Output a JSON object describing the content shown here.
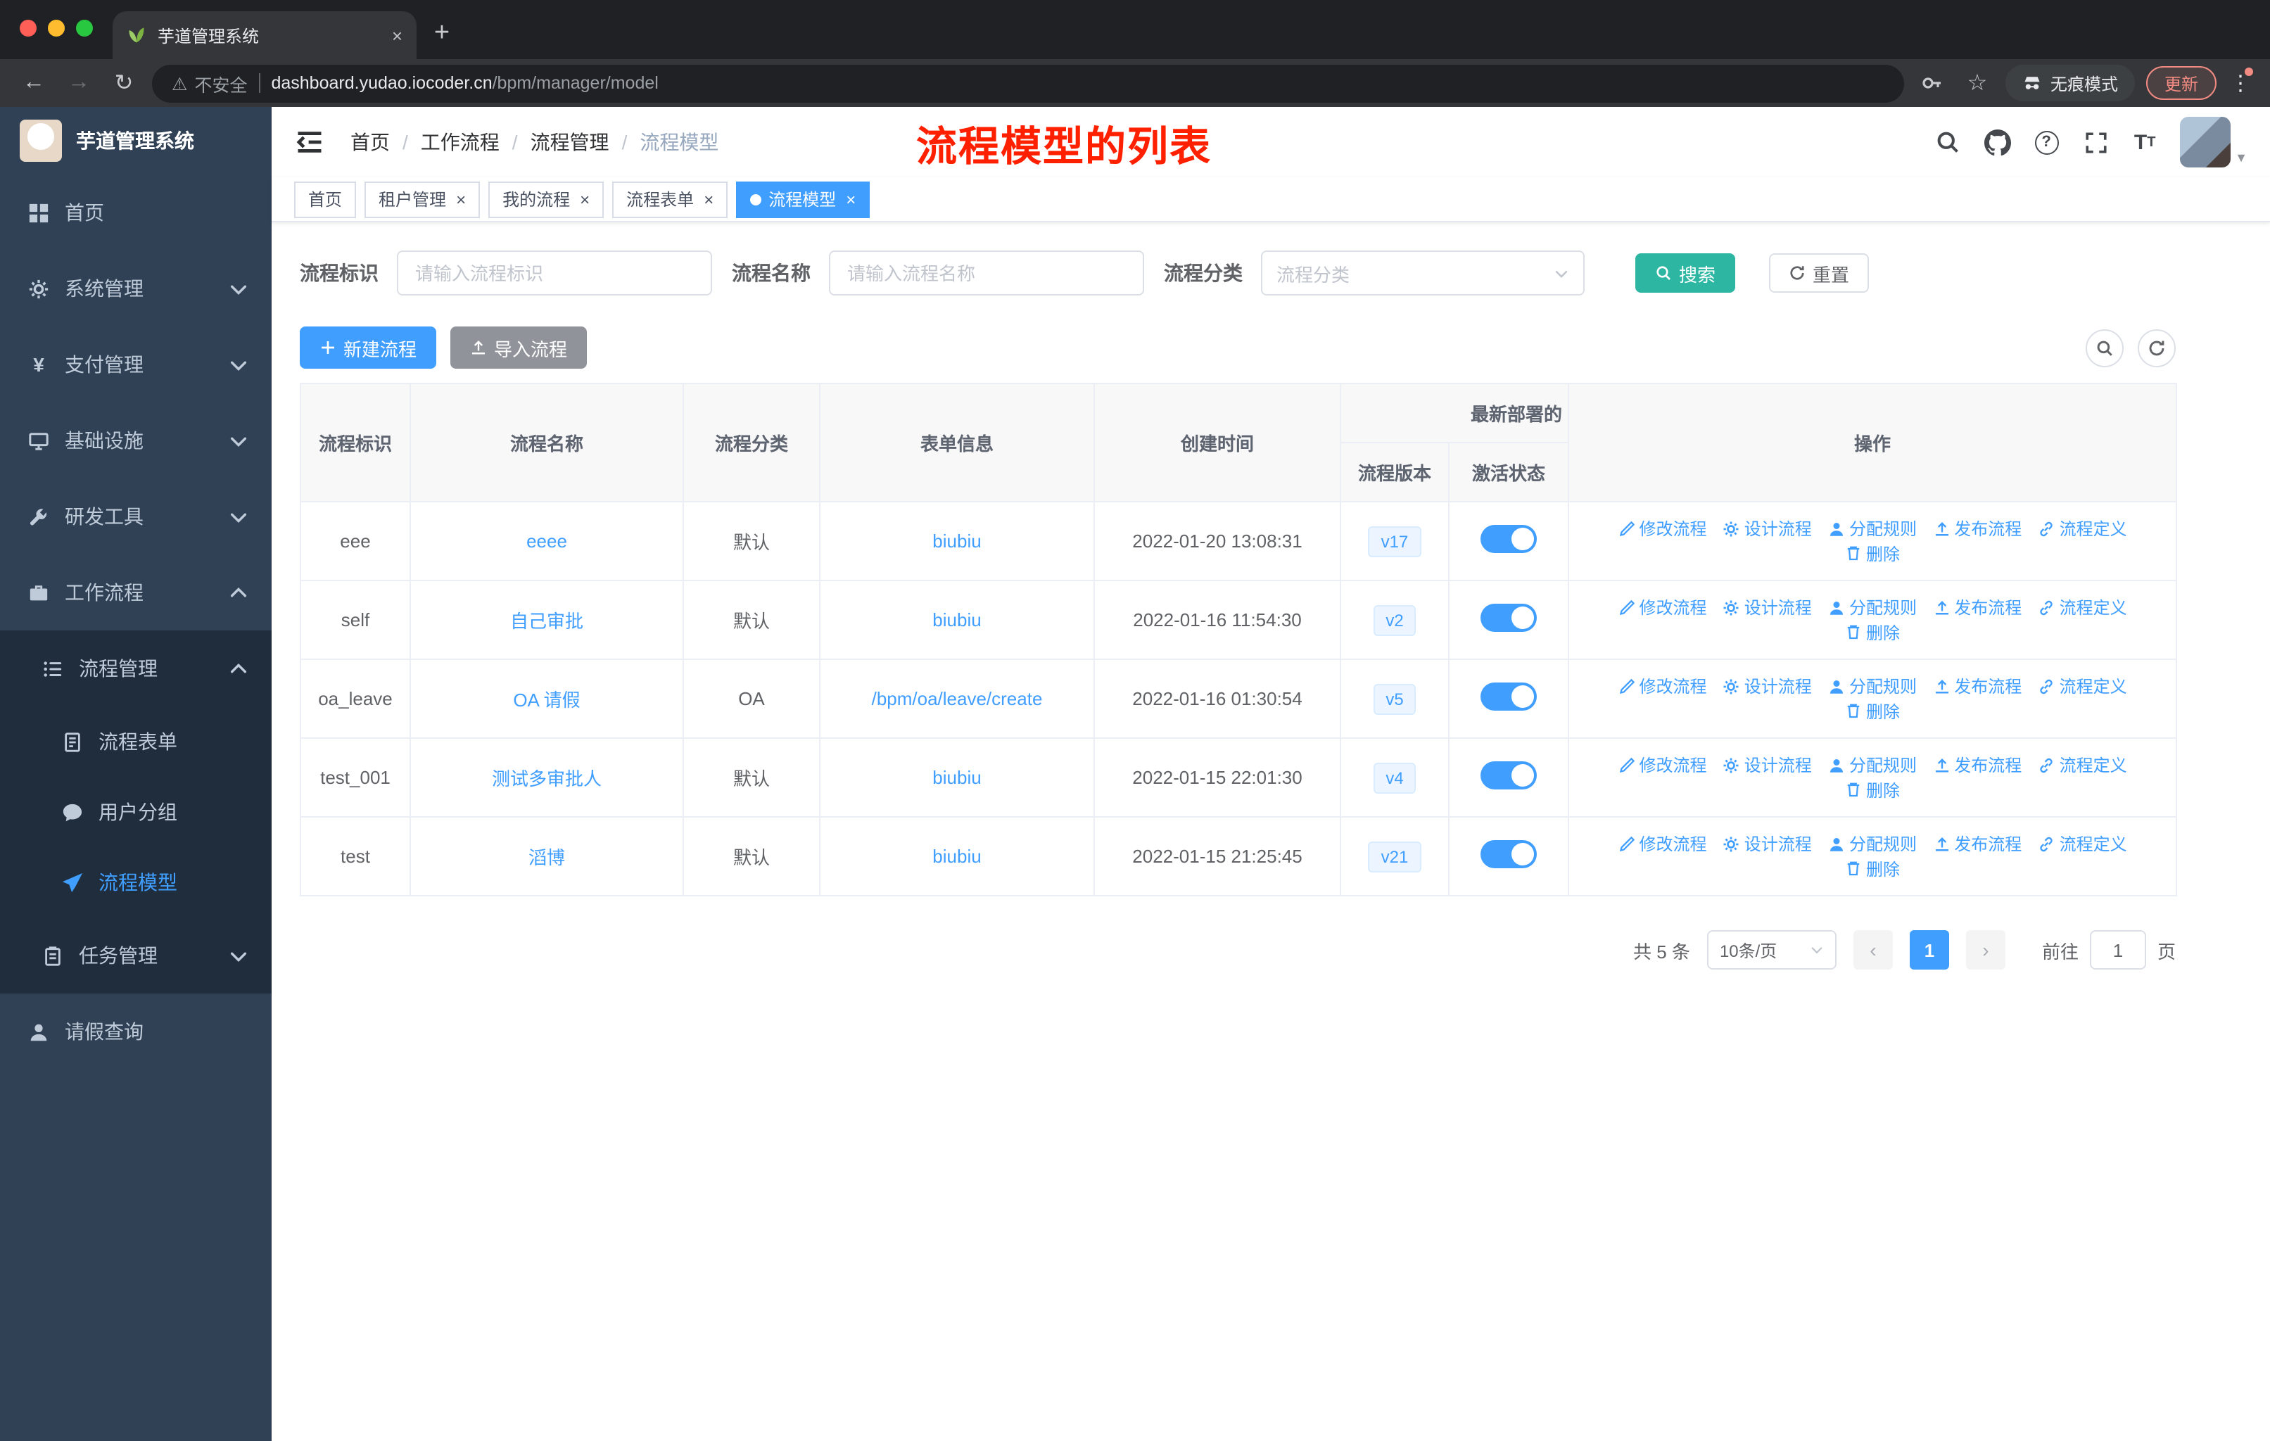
{
  "colors": {
    "primary": "#409eff",
    "search_button": "#2db7a3",
    "annotation_red": "#ff2000",
    "sidebar_bg": "#304156"
  },
  "browser": {
    "tab_title": "芋道管理系统",
    "security_label": "不安全",
    "url_host": "dashboard.yudao.iocoder.cn",
    "url_path": "/bpm/manager/model",
    "incognito_label": "无痕模式",
    "update_label": "更新"
  },
  "sidebar": {
    "logo_title": "芋道管理系统",
    "home": "首页",
    "system": "系统管理",
    "payment": "支付管理",
    "infra": "基础设施",
    "devtools": "研发工具",
    "workflow": "工作流程",
    "process_mgmt": "流程管理",
    "process_form": "流程表单",
    "user_group": "用户分组",
    "process_model": "流程模型",
    "task_mgmt": "任务管理",
    "leave_query": "请假查询"
  },
  "header": {
    "breadcrumb": {
      "home": "首页",
      "workflow": "工作流程",
      "process_mgmt": "流程管理",
      "current": "流程模型"
    },
    "annotation": "流程模型的列表"
  },
  "tags": [
    {
      "label": "首页"
    },
    {
      "label": "租户管理"
    },
    {
      "label": "我的流程"
    },
    {
      "label": "流程表单"
    },
    {
      "label": "流程模型"
    }
  ],
  "filters": {
    "key_label": "流程标识",
    "key_placeholder": "请输入流程标识",
    "name_label": "流程名称",
    "name_placeholder": "请输入流程名称",
    "category_label": "流程分类",
    "category_placeholder": "流程分类",
    "search": "搜索",
    "reset": "重置"
  },
  "toolbar": {
    "create": "新建流程",
    "import": "导入流程"
  },
  "table": {
    "headers": {
      "process_key": "流程标识",
      "process_name": "流程名称",
      "category": "流程分类",
      "form_info": "表单信息",
      "created_at": "创建时间",
      "deploy_group": "最新部署的",
      "version": "流程版本",
      "active_status": "激活状态",
      "operations": "操作"
    },
    "actions": [
      "修改流程",
      "设计流程",
      "分配规则",
      "发布流程",
      "流程定义",
      "删除"
    ],
    "rows": [
      {
        "key": "eee",
        "name": "eeee",
        "category": "默认",
        "form": "biubiu",
        "created": "2022-01-20 13:08:31",
        "version": "v17",
        "active": true
      },
      {
        "key": "self",
        "name": "自己审批",
        "category": "默认",
        "form": "biubiu",
        "created": "2022-01-16 11:54:30",
        "version": "v2",
        "active": true
      },
      {
        "key": "oa_leave",
        "name": "OA 请假",
        "category": "OA",
        "form": "/bpm/oa/leave/create",
        "created": "2022-01-16 01:30:54",
        "version": "v5",
        "active": true
      },
      {
        "key": "test_001",
        "name": "测试多审批人",
        "category": "默认",
        "form": "biubiu",
        "created": "2022-01-15 22:01:30",
        "version": "v4",
        "active": true
      },
      {
        "key": "test",
        "name": "滔博",
        "category": "默认",
        "form": "biubiu",
        "created": "2022-01-15 21:25:45",
        "version": "v21",
        "active": true
      }
    ]
  },
  "pagination": {
    "total": "共 5 条",
    "page_size": "10条/页",
    "current_page": "1",
    "goto_label": "前往",
    "goto_value": "1",
    "unit_label": "页"
  }
}
